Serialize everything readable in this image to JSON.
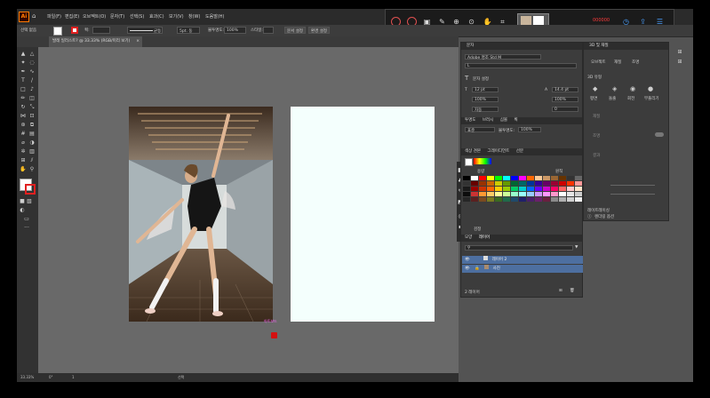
{
  "menu": {
    "items": [
      "파일(F)",
      "편집(E)",
      "오브젝트(O)",
      "문자(T)",
      "선택(S)",
      "효과(C)",
      "보기(V)",
      "창(W)",
      "도움말(H)"
    ]
  },
  "recorder": {
    "icons": [
      "record-circle-icon",
      "stop-circle-icon",
      "screenshot-icon",
      "pen-icon",
      "zoom-icon",
      "zoom-x1-icon",
      "hand-icon",
      "crop-icon",
      "webcam-icon",
      "timer-icon",
      "share-icon",
      "settings-icon"
    ],
    "timer": "000000"
  },
  "control_bar": {
    "selection": "선택 없음",
    "stroke_label": "획:",
    "stroke_value": "",
    "uniform": "균등",
    "brush": "5pt. 둥",
    "opacity_label": "불투명도:",
    "opacity_value": "100%",
    "style_label": "스타일:",
    "doc_setup": "문서 설정",
    "prefs": "환경 설정"
  },
  "document": {
    "tab_title": "발레 일러스트? @ 33.33% (RGB/미리 보기)"
  },
  "canvas": {
    "artboard_label": "아트보드"
  },
  "status": {
    "zoom": "33.33%",
    "angle": "0°",
    "page": "1",
    "mode": "선택"
  },
  "character_panel": {
    "title": "문자",
    "font": "Adobe 명조 Std M",
    "style": "L",
    "size": "12 pt",
    "leading": "14.4 pt",
    "vscale": "100%",
    "hscale": "100%",
    "kerning": "자동",
    "tracking": "0",
    "char_label": "문자 설정"
  },
  "transparency_panel": {
    "tabs": [
      "투명도",
      "브러시",
      "심볼",
      "획"
    ],
    "mode": "표준",
    "opacity_label": "불투명도:",
    "opacity": "100%"
  },
  "swatch_panel": {
    "tabs": [
      "색상 견본",
      "그레이디언트",
      "선분"
    ],
    "label_left": "용량",
    "label_right": "원칙",
    "footer": "검정"
  },
  "layers_panel": {
    "tabs": [
      "모양",
      "레이어"
    ],
    "rows": [
      {
        "name": "레이어 2"
      },
      {
        "name": "사진"
      }
    ],
    "footer": "2 레이어"
  },
  "props_panel": {
    "title": "3D 및 재질",
    "tabs": [
      "오브젝트",
      "재질",
      "조명"
    ],
    "section": "3D 유형",
    "types": [
      "평면",
      "돌출",
      "회전",
      "부풀리기"
    ],
    "rows": [
      "재질",
      "조명",
      "결과",
      "레이트레이싱"
    ],
    "footer": "렌더링 옵션"
  },
  "colors": {
    "swatch_rows": [
      [
        "#000000",
        "#ffffff",
        "#ff0000",
        "#ffff00",
        "#00ff00",
        "#00ffff",
        "#0000ff",
        "#ff00ff",
        "#ff6600",
        "#ffcc99",
        "#cc9966",
        "#996633",
        "#663300",
        "#333333",
        "#666666"
      ],
      [
        "#333333",
        "#660000",
        "#993300",
        "#cc6600",
        "#cccc00",
        "#669900",
        "#006633",
        "#006666",
        "#003399",
        "#330099",
        "#660066",
        "#990033",
        "#cc0000",
        "#ff3300",
        "#ff9999"
      ],
      [
        "#1a1a1a",
        "#990000",
        "#cc3300",
        "#ff6600",
        "#ffcc00",
        "#99cc00",
        "#00cc66",
        "#00cccc",
        "#0066ff",
        "#6600ff",
        "#cc00cc",
        "#ff0066",
        "#ff6666",
        "#ffcccc",
        "#ffe6cc"
      ],
      [
        "#0d0d0d",
        "#cc3333",
        "#ff9933",
        "#ffcc66",
        "#ffff99",
        "#ccff99",
        "#99ffcc",
        "#99ffff",
        "#99ccff",
        "#cc99ff",
        "#ff99ff",
        "#ff99cc",
        "#ffffff",
        "#e6e6e6",
        "#cccccc"
      ],
      [
        "#262626",
        "#5a2020",
        "#7a4a20",
        "#7a7a20",
        "#3a6a20",
        "#206a4a",
        "#204a6a",
        "#20206a",
        "#4a206a",
        "#6a206a",
        "#6a2040",
        "#8a8a8a",
        "#b0b0b0",
        "#d0d0d0",
        "#f0f0f0"
      ]
    ]
  }
}
